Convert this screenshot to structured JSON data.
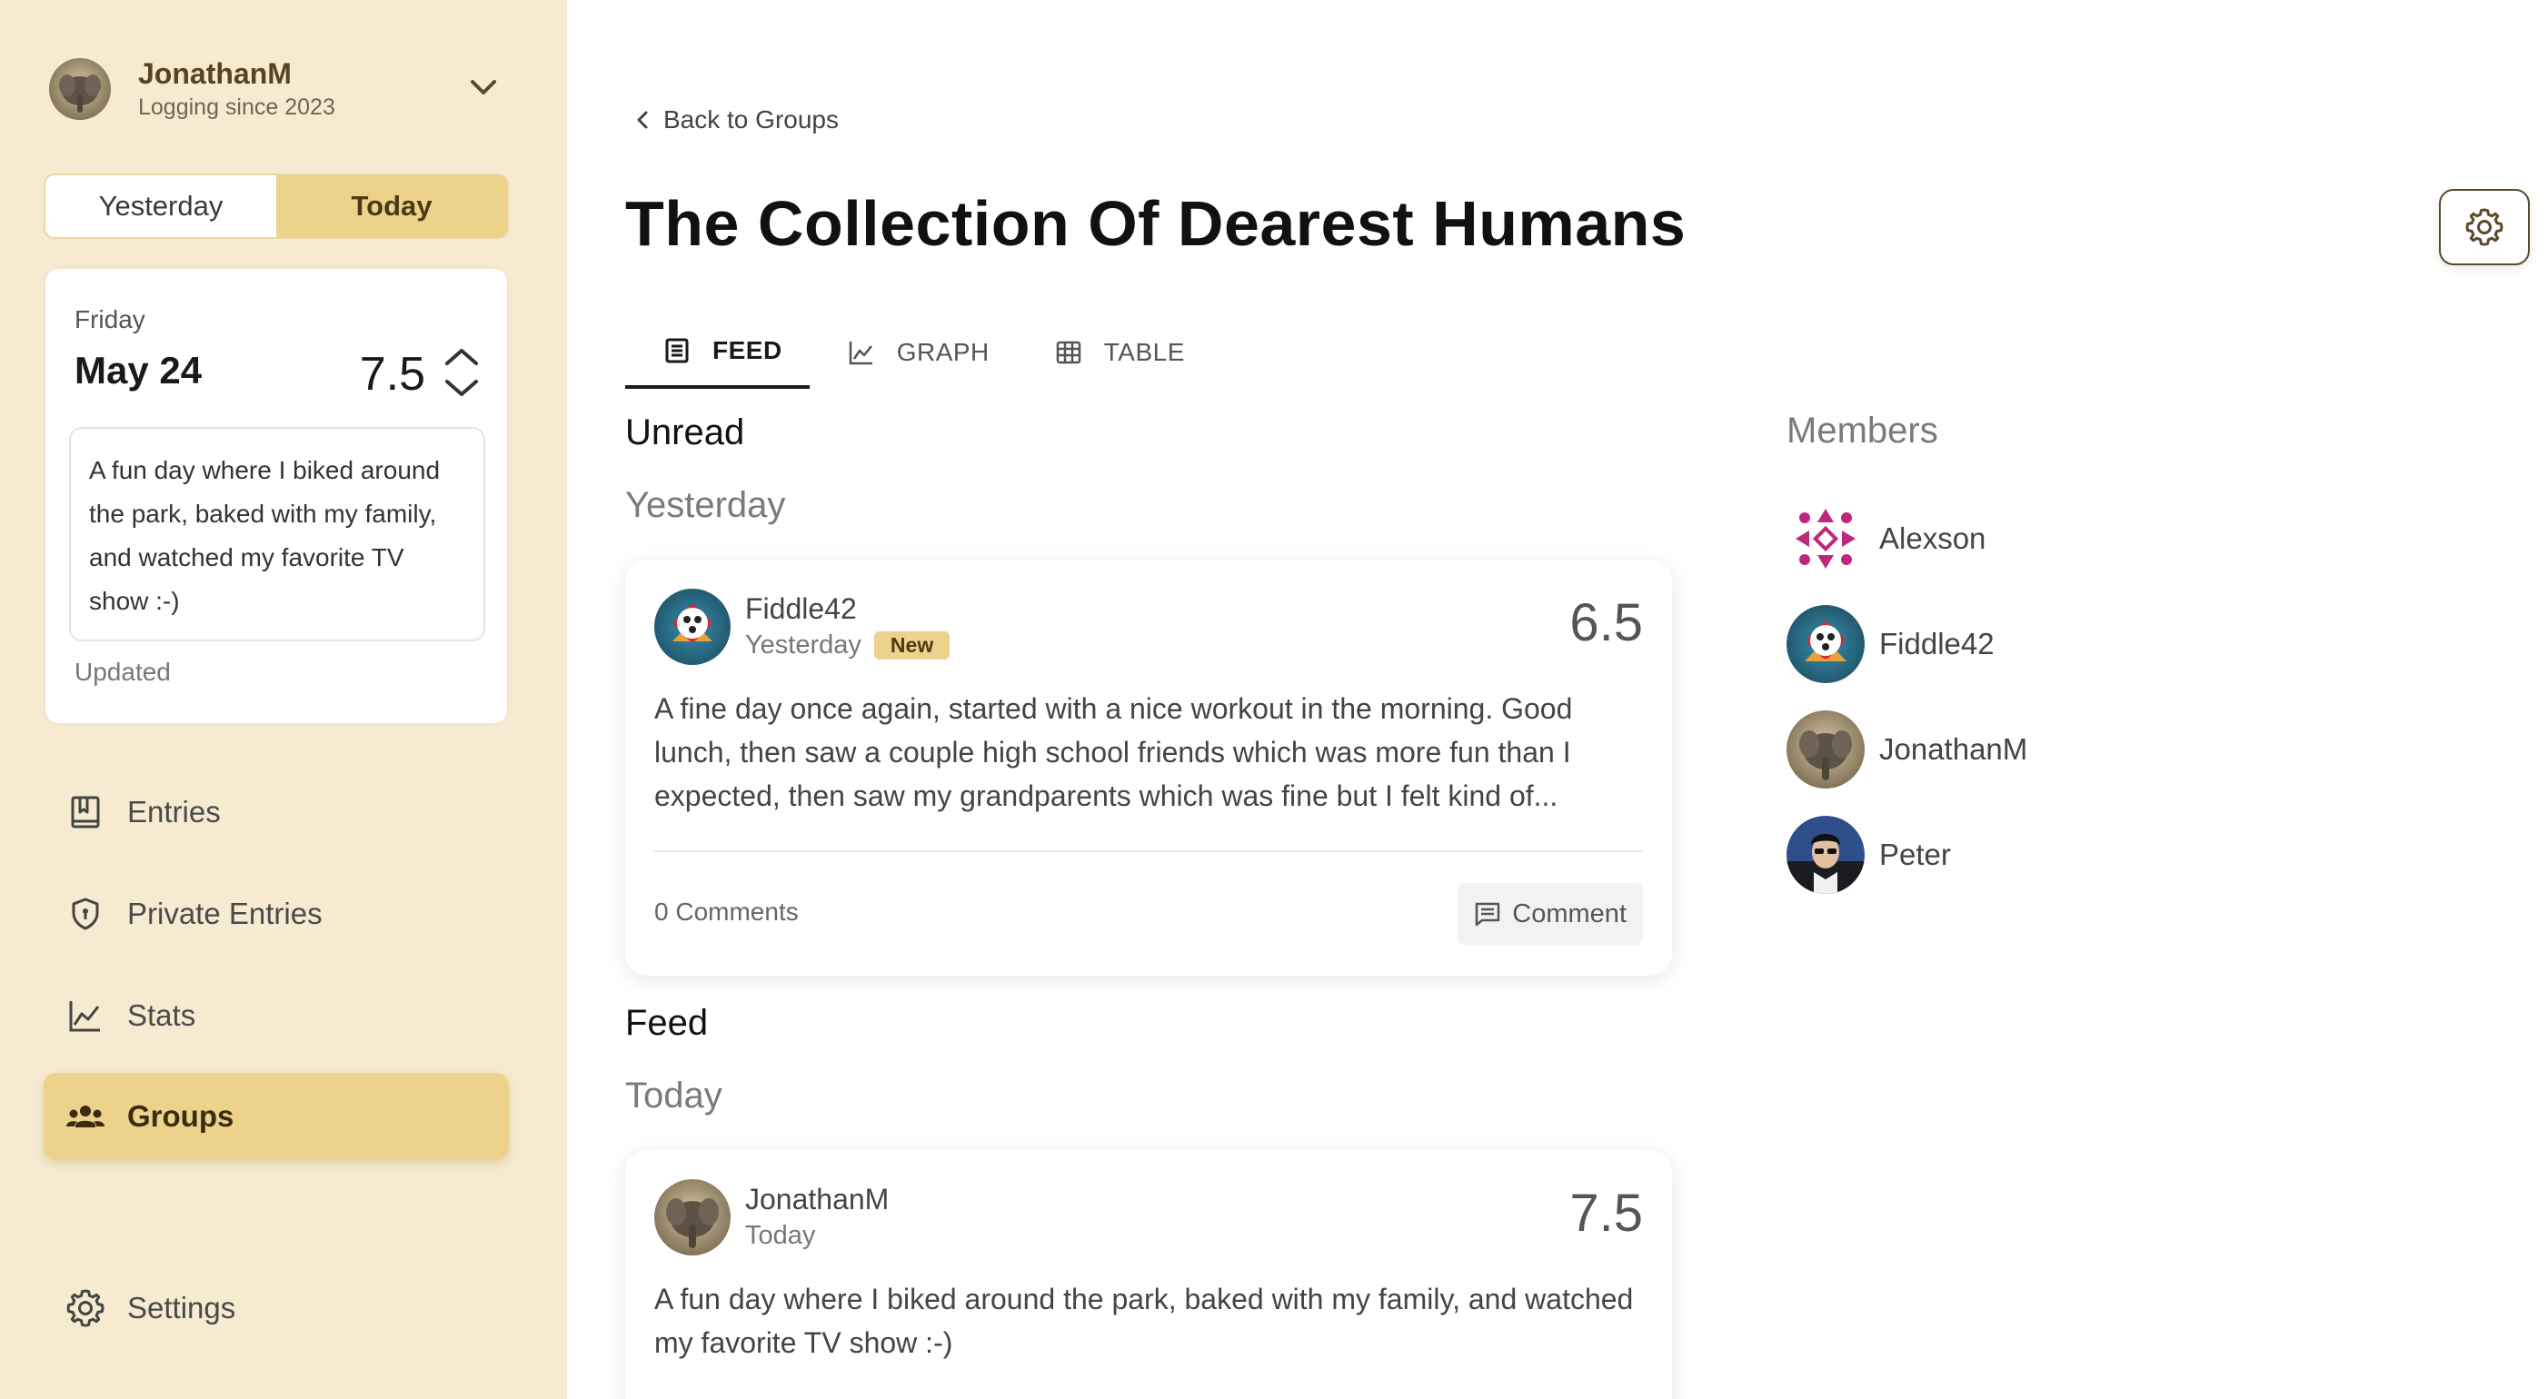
{
  "user": {
    "name": "JonathanM",
    "subtitle": "Logging since 2023"
  },
  "day_toggle": {
    "yesterday": "Yesterday",
    "today": "Today",
    "active": "today"
  },
  "day_card": {
    "weekday": "Friday",
    "date": "May 24",
    "score": "7.5",
    "entry": "A fun day where I biked around the park, baked with my family, and watched my favorite TV show :-)",
    "status": "Updated"
  },
  "nav": {
    "entries": "Entries",
    "private_entries": "Private Entries",
    "stats": "Stats",
    "groups": "Groups",
    "settings": "Settings",
    "active": "groups"
  },
  "main": {
    "back_link": "Back to Groups",
    "title": "The Collection Of Dearest Humans",
    "tabs": {
      "feed": "FEED",
      "graph": "GRAPH",
      "table": "TABLE",
      "active": "feed"
    },
    "unread": {
      "title": "Unread",
      "group": "Yesterday",
      "post": {
        "author": "Fiddle42",
        "when": "Yesterday",
        "badge": "New",
        "score": "6.5",
        "body": "A fine day once again, started with a nice workout in the morning. Good lunch, then saw a couple high school friends which was more fun than I expected, then saw my grandparents which was fine but I felt kind of...",
        "comments": "0 Comments",
        "comment_button": "Comment"
      }
    },
    "feed": {
      "title": "Feed",
      "group": "Today",
      "post": {
        "author": "JonathanM",
        "when": "Today",
        "score": "7.5",
        "body": "A fun day where I biked around the park, baked with my family, and watched my favorite TV show :-)"
      }
    }
  },
  "members": {
    "title": "Members",
    "list": [
      "Alexson",
      "Fiddle42",
      "JonathanM",
      "Peter"
    ]
  },
  "colors": {
    "sidebar_bg": "#f6ebd0",
    "accent": "#ecd28a",
    "badge": "#ecd28a"
  }
}
